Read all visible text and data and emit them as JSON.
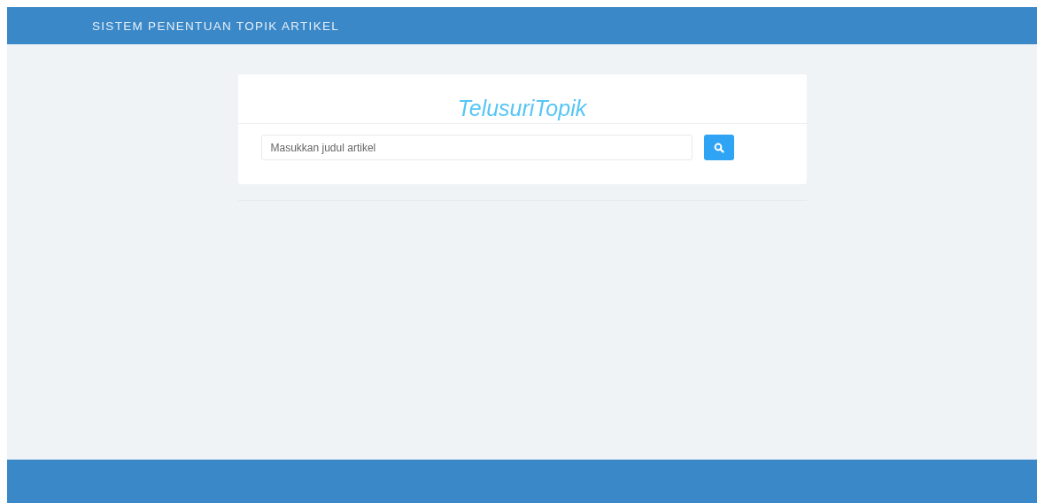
{
  "header": {
    "title": "SISTEM PENENTUAN TOPIK ARTIKEL"
  },
  "search_card": {
    "title": "TelusuriTopik",
    "search": {
      "placeholder": "Masukkan judul artikel"
    }
  }
}
